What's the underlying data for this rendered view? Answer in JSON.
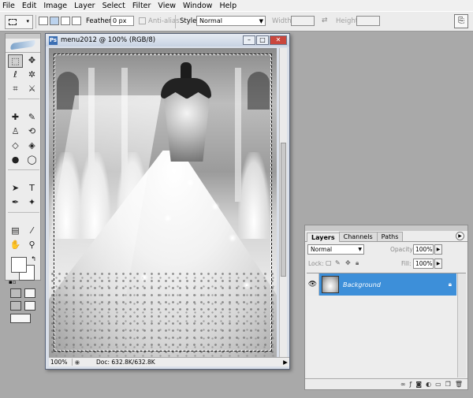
{
  "menubar": {
    "items": [
      "File",
      "Edit",
      "Image",
      "Layer",
      "Select",
      "Filter",
      "View",
      "Window",
      "Help"
    ]
  },
  "options": {
    "feather_label": "Feather:",
    "feather_value": "0 px",
    "antialias_label": "Anti-alias",
    "style_label": "Style:",
    "style_value": "Normal",
    "width_label": "Width:",
    "height_label": "Height:"
  },
  "document": {
    "title": "menu2012 @ 100% (RGB/8)",
    "zoom": "100%",
    "doc_size": "Doc: 632.8K/632.8K"
  },
  "layers_panel": {
    "tabs": [
      "Layers",
      "Channels",
      "Paths"
    ],
    "blend_mode": "Normal",
    "opacity_label": "Opacity:",
    "opacity_value": "100%",
    "lock_label": "Lock:",
    "fill_label": "Fill:",
    "fill_value": "100%",
    "layer_name": "Background"
  },
  "colors": {
    "accent": "#3d8fd9",
    "workspace": "#a9a9a9",
    "close": "#c9463d"
  }
}
